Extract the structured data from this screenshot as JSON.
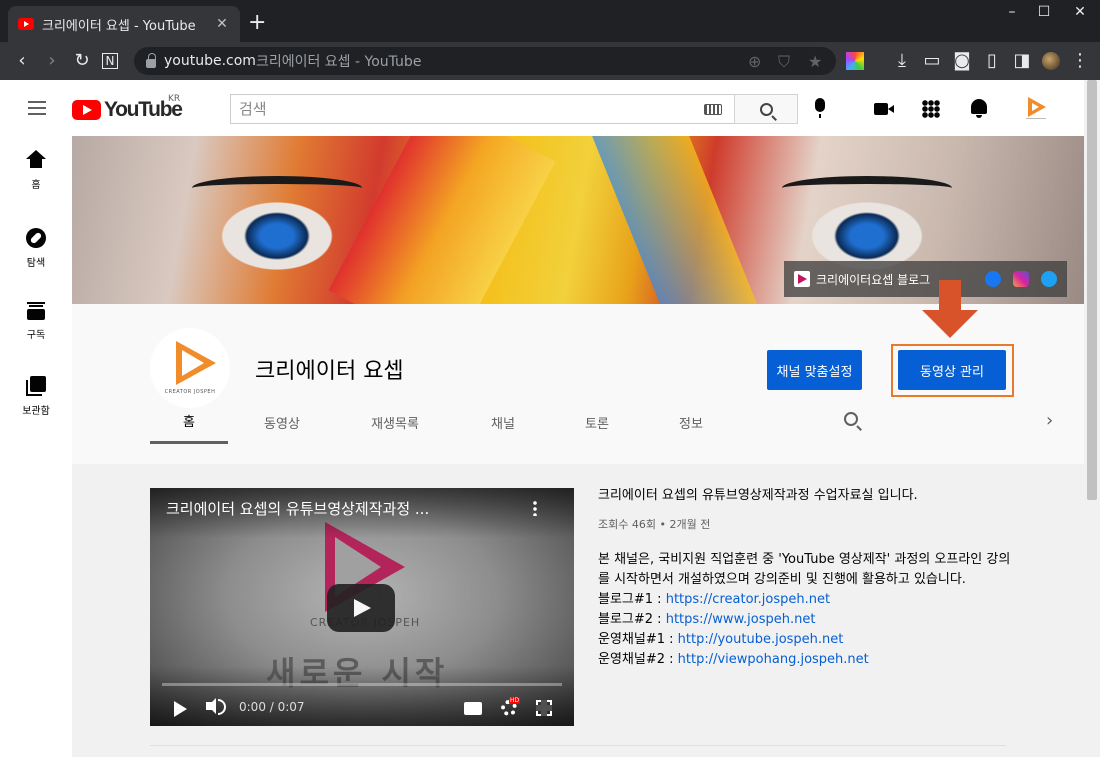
{
  "browser": {
    "tab_title": "크리에이터 요셉 - YouTube",
    "new_tab_label": "+",
    "window_controls": [
      "minimize-icon",
      "maximize-icon",
      "close-icon"
    ],
    "url_host": "youtube.com",
    "url_rest": " 크리에이터 요셉 - YouTube",
    "nav_icons": [
      "back-icon",
      "forward-icon",
      "reload-icon",
      "notion-icon"
    ],
    "toolbar_icons": [
      "extension-icon",
      "download-icon",
      "camera-icon",
      "screenshot-icon",
      "reader-icon",
      "sidebar-icon",
      "profile-avatar",
      "menu-icon"
    ]
  },
  "masthead": {
    "logo_text": "YouTube",
    "country_code": "KR",
    "search_placeholder": "검색",
    "search_value": ""
  },
  "sidebar": {
    "items": [
      {
        "label": "홈",
        "icon": "home-icon"
      },
      {
        "label": "탐색",
        "icon": "explore-icon"
      },
      {
        "label": "구독",
        "icon": "subscriptions-icon"
      },
      {
        "label": "보관함",
        "icon": "library-icon"
      }
    ]
  },
  "banner": {
    "link_text": "크리에이터요셉 블로그",
    "social_icons": [
      "facebook-icon",
      "instagram-icon",
      "twitter-icon"
    ],
    "colors": {
      "facebook": "#1877f2",
      "instagram": "#d6249f",
      "twitter": "#1da1f2"
    }
  },
  "channel": {
    "name": "크리에이터 요셉",
    "avatar_caption": "CREATOR JOSPEH",
    "customize_label": "채널 맞춤설정",
    "manage_label": "동영상 관리",
    "tabs": [
      "홈",
      "동영상",
      "재생목록",
      "채널",
      "토론",
      "정보"
    ],
    "active_tab": "홈"
  },
  "featured": {
    "video_title": "크리에이터 요셉의 유튜브영상제작과정 ...",
    "watermark_brand": "CREATOR JOSPEH",
    "watermark_text": "새로운 시작",
    "time": "0:00 / 0:07",
    "progress": 0,
    "quality_badge": "HD",
    "desc_title": "크리에이터 요셉의 유튜브영상제작과정 수업자료실 입니다.",
    "meta": "조회수 46회 • 2개월 전",
    "body": "본 채널은, 국비지원 직업훈련 중 'YouTube 영상제작' 과정의 오프라인 강의를 시작하면서 개설하였으며 강의준비 및 진행에 활용하고 있습니다.",
    "links": [
      {
        "label": "블로그#1 : ",
        "url": "https://creator.jospeh.net"
      },
      {
        "label": "블로그#2 : ",
        "url": "https://www.jospeh.net"
      },
      {
        "label": "운영채널#1 : ",
        "url": "http://youtube.jospeh.net"
      },
      {
        "label": "운영채널#2 : ",
        "url": "http://viewpohang.jospeh.net"
      }
    ]
  },
  "colors": {
    "accent_blue": "#065fd4",
    "highlight_orange": "#ea7a2b",
    "youtube_red": "#ff0000"
  }
}
